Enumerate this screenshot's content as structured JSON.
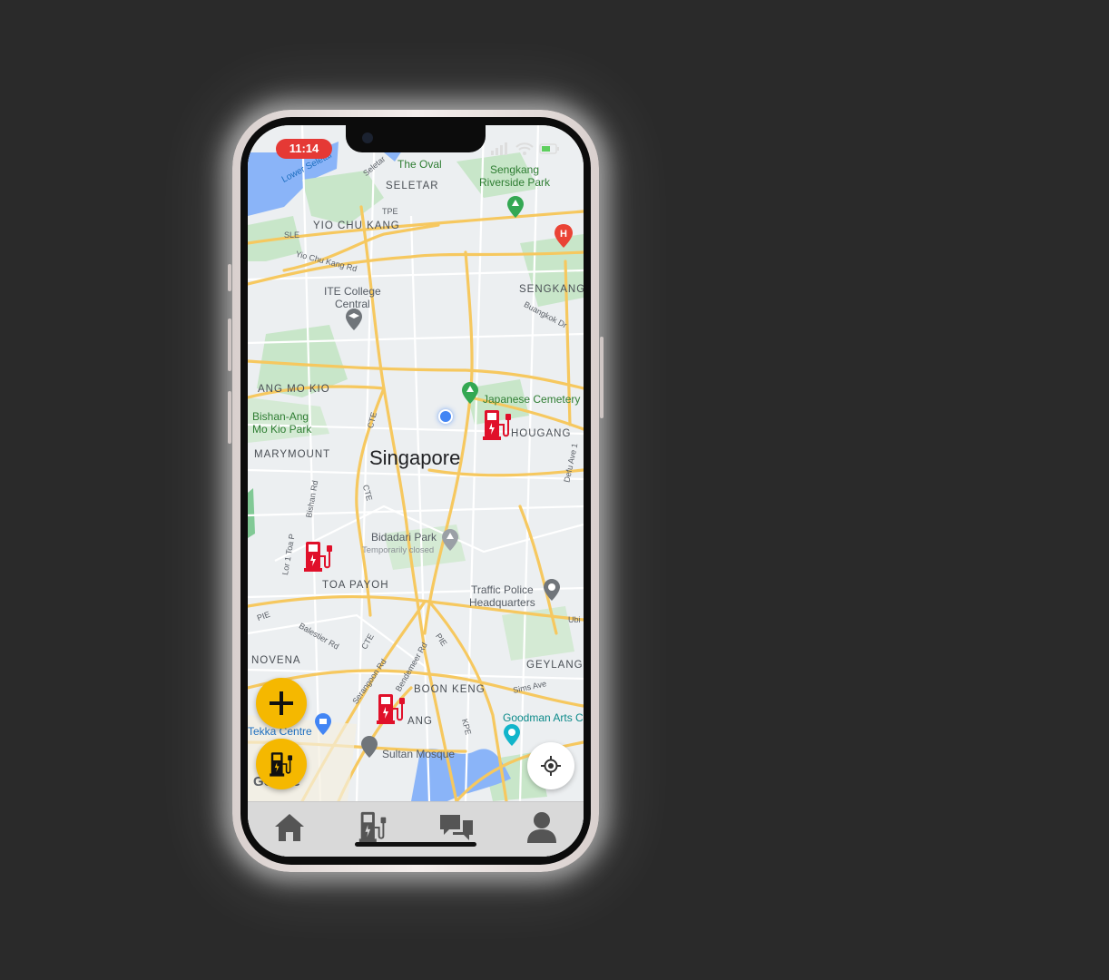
{
  "status_bar": {
    "time": "11:14"
  },
  "map": {
    "city_label": "Singapore",
    "area_labels": {
      "seletar": "SELETAR",
      "yio_chu_kang": "YIO CHU KANG",
      "sengkang": "SENGKANG",
      "ang_mo_kio": "ANG MO KIO",
      "marymount": "MARYMOUNT",
      "hougang": "HOUGANG",
      "toa_payoh": "TOA PAYOH",
      "novena": "NOVENA",
      "boon_keng": "BOON KENG",
      "geylang": "GEYLANG",
      "kallang": "ANG"
    },
    "place_labels": {
      "the_oval": "The Oval",
      "sengkang_park": "Sengkang\nRiverside Park",
      "lower_seletar": "Lower Seletar",
      "ite_college": "ITE College\nCentral",
      "japanese_cemetery": "Japanese Cemetery",
      "bishan_park": "Bishan-Ang\nMo Kio Park",
      "bidadari_park": "Bidadari Park",
      "bidadari_status": "Temporarily closed",
      "traffic_police": "Traffic Police\nHeadquarters",
      "tekka_centre": "Tekka Centre",
      "sultan_mosque": "Sultan Mosque",
      "goodman_arts": "Goodman Arts C"
    },
    "road_labels": {
      "tpe": "TPE",
      "sle": "SLE",
      "yio_chu_kang_rd": "Yio Chu Kang Rd",
      "buangkok_dr": "Buangkok Dr",
      "cte1": "CTE",
      "cte2": "CTE",
      "cte3": "CTE",
      "defu_ave": "Defu Ave 1",
      "bishan_rd": "Bishan Rd",
      "lor_toa_payoh": "Lor 1 Toa P",
      "pie1": "PIE",
      "pie2": "PIE",
      "balestier_rd": "Balestier Rd",
      "serangoon_rd": "Serangoon Rd",
      "bendemeer_rd": "Bendemeer Rd",
      "sims_ave": "Sims Ave",
      "kpe": "KPE",
      "ubi": "Ubi",
      "seletar_road": "Seletar"
    },
    "google_attribution": "Google"
  },
  "colors": {
    "accent_yellow": "#f5b800",
    "charger_red": "#e0102a",
    "time_pill_red": "#e53935"
  },
  "icons": {
    "fab_add": "plus-icon",
    "fab_charger": "ev-charger-icon",
    "locate": "crosshair-icon",
    "tabs": [
      "home-icon",
      "ev-station-icon",
      "chat-icon",
      "profile-icon"
    ]
  }
}
